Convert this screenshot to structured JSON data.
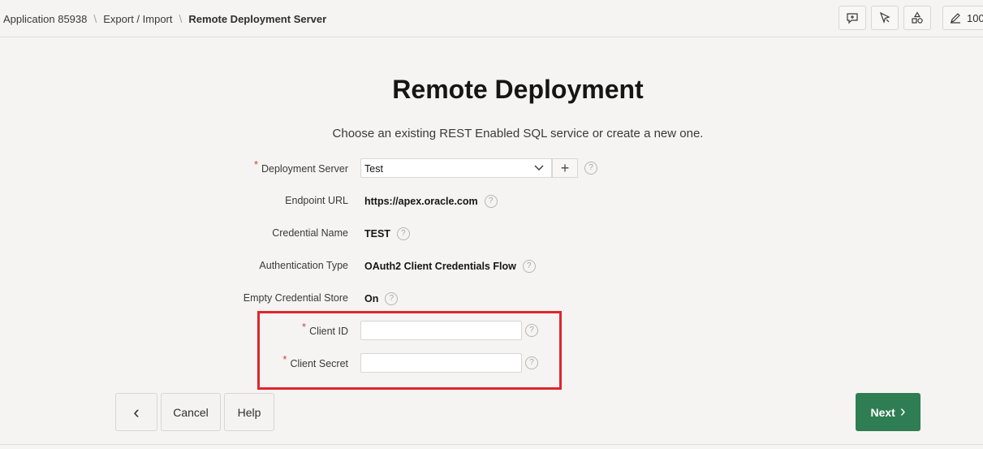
{
  "breadcrumb": {
    "items": [
      "Application 85938",
      "Export / Import"
    ],
    "current": "Remote Deployment Server",
    "separator": "\\"
  },
  "toolbar": {
    "buttons": [
      {
        "icon": "comment-plus-icon"
      },
      {
        "icon": "pointer-magic-icon"
      },
      {
        "icon": "shapes-icon"
      },
      {
        "icon": "edit-icon",
        "label": "100"
      }
    ]
  },
  "page": {
    "title": "Remote Deployment",
    "subtitle": "Choose an existing REST Enabled SQL service or create a new one."
  },
  "form": {
    "deployment_server": {
      "label": "Deployment Server",
      "required": "*",
      "value": "Test",
      "add_label": "+"
    },
    "endpoint_url": {
      "label": "Endpoint URL",
      "value": "https://apex.oracle.com"
    },
    "credential_name": {
      "label": "Credential Name",
      "value": "TEST"
    },
    "authentication_type": {
      "label": "Authentication Type",
      "value": "OAuth2 Client Credentials Flow"
    },
    "empty_credential_store": {
      "label": "Empty Credential Store",
      "value": "On"
    },
    "client_id": {
      "label": "Client ID",
      "required": "*",
      "value": ""
    },
    "client_secret": {
      "label": "Client Secret",
      "required": "*",
      "value": ""
    },
    "help_glyph": "?"
  },
  "buttons": {
    "back": "‹",
    "cancel": "Cancel",
    "help": "Help",
    "next": "Next",
    "next_chevron": "›"
  },
  "colors": {
    "accent": "#2f7d52",
    "highlight": "#e0252e",
    "required": "#c74634"
  }
}
